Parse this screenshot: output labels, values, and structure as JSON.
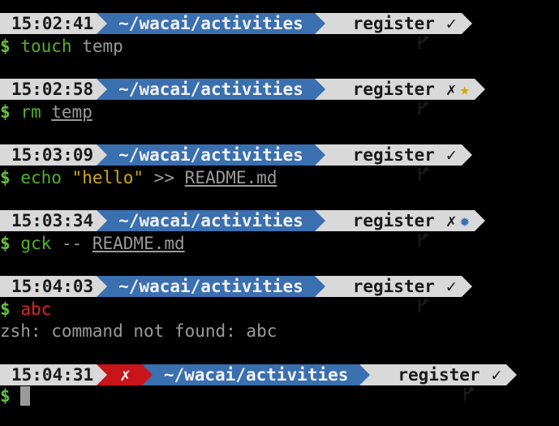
{
  "colors": {
    "background": "#000000",
    "segment_light": "#d9d9d9",
    "segment_path": "#3a6fb0",
    "segment_error": "#c8141b",
    "dollar": "#62c23a",
    "command": "#4fb32a",
    "command_invalid": "#e0241e",
    "string": "#d0a818",
    "star": "#d4a710"
  },
  "prompts": [
    {
      "time": "15:02:41",
      "path": "~/wacai/activities",
      "branch": "register",
      "status": "✓",
      "extra": ""
    },
    {
      "time": "15:02:58",
      "path": "~/wacai/activities",
      "branch": "register",
      "status": "✗",
      "extra": "★"
    },
    {
      "time": "15:03:09",
      "path": "~/wacai/activities",
      "branch": "register",
      "status": "✓",
      "extra": ""
    },
    {
      "time": "15:03:34",
      "path": "~/wacai/activities",
      "branch": "register",
      "status": "✗",
      "extra": "✹"
    },
    {
      "time": "15:04:03",
      "path": "~/wacai/activities",
      "branch": "register",
      "status": "✓",
      "extra": ""
    },
    {
      "time": "15:04:31",
      "error": "✗",
      "path": "~/wacai/activities",
      "branch": "register",
      "status": "✓",
      "extra": ""
    }
  ],
  "commands": [
    {
      "dollar": "$",
      "cmd": "touch",
      "args": "temp"
    },
    {
      "dollar": "$",
      "cmd": "rm",
      "args": "temp"
    },
    {
      "dollar": "$",
      "cmd": "echo",
      "string": "\"hello\"",
      "op": ">>",
      "file": "README.md"
    },
    {
      "dollar": "$",
      "cmd": "gck",
      "op": "--",
      "file": "README.md"
    },
    {
      "dollar": "$",
      "cmd": "abc"
    },
    {
      "dollar": "$"
    }
  ],
  "output": {
    "error_line": "zsh: command not found: abc"
  }
}
